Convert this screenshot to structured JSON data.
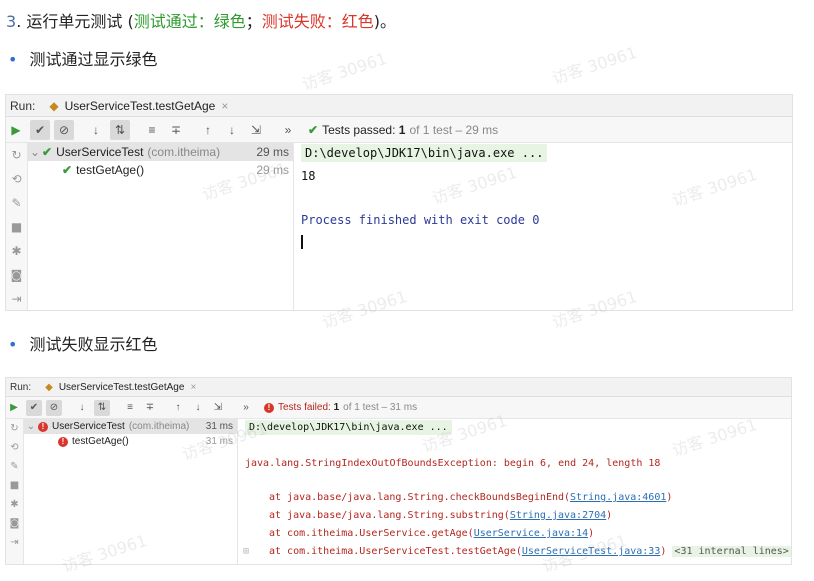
{
  "heading": {
    "num": "3",
    "text": ". 运行单元测试 (",
    "pass": "测试通过：绿色",
    "sep": "；",
    "fail": "测试失败：红色",
    "end": ")。"
  },
  "bullets": {
    "pass": "测试通过显示绿色",
    "fail": "测试失败显示红色"
  },
  "watermark": "访客 30961",
  "panel_pass": {
    "run_label": "Run:",
    "tab": "UserServiceTest.testGetAge",
    "status_prefix": "Tests passed:",
    "status_count": "1",
    "status_rest": "of 1 test – 29 ms",
    "tree": {
      "suite": {
        "name": "UserServiceTest",
        "pkg": "(com.itheima)",
        "duration": "29 ms"
      },
      "test": {
        "name": "testGetAge()",
        "duration": "29 ms"
      }
    },
    "console": {
      "cmd": "D:\\develop\\JDK17\\bin\\java.exe ...",
      "output": "18",
      "finish": "Process finished with exit code 0"
    }
  },
  "panel_fail": {
    "run_label": "Run:",
    "tab": "UserServiceTest.testGetAge",
    "status_prefix": "Tests failed:",
    "status_count": "1",
    "status_rest": "of 1 test – 31 ms",
    "tree": {
      "suite": {
        "name": "UserServiceTest",
        "pkg": "(com.itheima)",
        "duration": "31 ms"
      },
      "test": {
        "name": "testGetAge()",
        "duration": "31 ms"
      }
    },
    "console": {
      "cmd": "D:\\develop\\JDK17\\bin\\java.exe ...",
      "exception": "java.lang.StringIndexOutOfBoundsException: begin 6, end 24, length 18",
      "frames": [
        {
          "prefix": "at java.base/java.lang.String.checkBoundsBeginEnd(",
          "link": "String.java:4601",
          "suffix": ")"
        },
        {
          "prefix": "at java.base/java.lang.String.substring(",
          "link": "String.java:2704",
          "suffix": ")"
        },
        {
          "prefix": "at com.itheima.UserService.getAge(",
          "link": "UserService.java:14",
          "suffix": ")"
        },
        {
          "prefix": "at com.itheima.UserServiceTest.testGetAge(",
          "link": "UserServiceTest.java:33",
          "suffix": ")"
        }
      ],
      "internal": "<31 internal lines>"
    }
  }
}
